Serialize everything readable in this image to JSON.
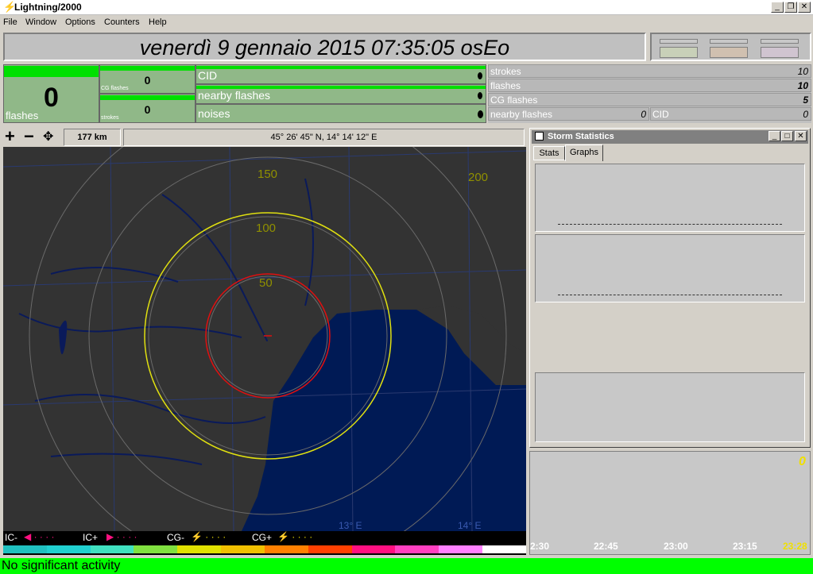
{
  "window": {
    "title": "Lightning/2000"
  },
  "menu": [
    "File",
    "Window",
    "Options",
    "Counters",
    "Help"
  ],
  "header": {
    "datetime": "venerdì 9 gennaio 2015 07:35:05 osEo"
  },
  "counters": {
    "flashes_value": "0",
    "flashes_label": "flashes",
    "cg_flashes_value": "0",
    "cg_flashes_label": "CG flashes",
    "strokes_value": "0",
    "strokes_label": "strokes",
    "cid_label": "CID",
    "nearby_label": "nearby flashes",
    "noises_label": "noises"
  },
  "stats": {
    "strokes_label": "strokes",
    "strokes_value": "10",
    "flashes_label": "flashes",
    "flashes_value": "10",
    "cg_label": "CG flashes",
    "cg_value": "5",
    "nearby_label": "nearby flashes",
    "nearby_value": "0",
    "cid_label": "CID",
    "cid_value": "0"
  },
  "map": {
    "range": "177 km",
    "coords": "45° 26' 45\" N, 14° 14' 12\" E",
    "ring_labels": [
      "50",
      "100",
      "150",
      "200"
    ],
    "lon_labels": [
      "13° E",
      "14° E"
    ]
  },
  "legend": {
    "ic_minus": "IC-",
    "ic_plus": "IC+",
    "cg_minus": "CG-",
    "cg_plus": "CG+",
    "colors": [
      "#20c0c0",
      "#20d0d0",
      "#40e0c0",
      "#80e040",
      "#e0e000",
      "#f0c000",
      "#ff8000",
      "#ff4000",
      "#ff1080",
      "#ff40c0",
      "#ff80ff",
      "#ffffff"
    ]
  },
  "storm": {
    "title": "Storm Statistics",
    "tab_stats": "Stats",
    "tab_graphs": "Graphs"
  },
  "timeline": {
    "count": "0",
    "ticks": [
      "2:30",
      "22:45",
      "23:00",
      "23:15",
      "23:28"
    ]
  },
  "status": {
    "text": "No significant activity"
  }
}
